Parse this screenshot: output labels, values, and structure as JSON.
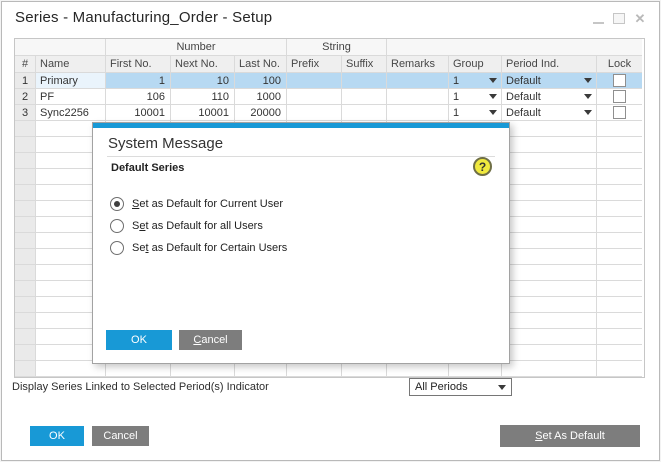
{
  "window": {
    "title": "Series - Manufacturing_Order - Setup",
    "icons": {
      "minimize": "minimize",
      "maximize": "maximize",
      "close": "✕"
    }
  },
  "colors": {
    "accent_blue": "#1899d6",
    "selection_blue": "#b7d9f2",
    "button_gray": "#7d7d7d"
  },
  "table": {
    "groups": [
      {
        "label": "Number"
      },
      {
        "label": "String"
      }
    ],
    "columns": [
      "#",
      "Name",
      "First No.",
      "Next No.",
      "Last No.",
      "Prefix",
      "Suffix",
      "Remarks",
      "Group",
      "Period Ind.",
      "Lock"
    ],
    "rows": [
      {
        "num": "1",
        "name": "Primary",
        "first_no": "1",
        "next_no": "10",
        "last_no": "100",
        "prefix": "",
        "suffix": "",
        "remarks": "",
        "group": "1",
        "period_ind": "Default",
        "locked": false,
        "selected": true
      },
      {
        "num": "2",
        "name": "PF",
        "first_no": "106",
        "next_no": "110",
        "last_no": "1000",
        "prefix": "",
        "suffix": "",
        "remarks": "",
        "group": "1",
        "period_ind": "Default",
        "locked": false,
        "selected": false
      },
      {
        "num": "3",
        "name": "Sync2256",
        "first_no": "10001",
        "next_no": "10001",
        "last_no": "20000",
        "prefix": "",
        "suffix": "",
        "remarks": "",
        "group": "1",
        "period_ind": "Default",
        "locked": false,
        "selected": false
      }
    ],
    "empty_row_count": 16
  },
  "modal": {
    "title": "System Message",
    "subtitle": "Default Series",
    "help_icon": "?",
    "options": [
      {
        "label": "Set as Default for Current User",
        "selected": true,
        "mnemonic_index": 0
      },
      {
        "label": "Set as Default for all Users",
        "selected": false,
        "mnemonic_index": 1
      },
      {
        "label": "Set as Default for Certain Users",
        "selected": false,
        "mnemonic_index": 2
      }
    ],
    "ok_label": "OK",
    "cancel": {
      "label": "Cancel",
      "mnemonic_index": 0
    }
  },
  "footer": {
    "period_filter_label": "Display Series Linked to Selected Period(s) Indicator",
    "period_dropdown_value": "All Periods",
    "ok_label": "OK",
    "cancel_label": "Cancel",
    "set_as_default": {
      "label": "Set As Default",
      "mnemonic_index": 0
    }
  }
}
